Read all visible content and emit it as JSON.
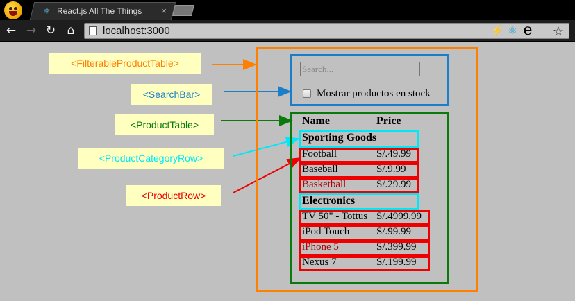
{
  "browser": {
    "tab_title": "React.js All The Things",
    "tab_close": "×",
    "url": "localhost:3000",
    "icons": {
      "back": "←",
      "forward": "→",
      "reload": "↻",
      "home": "⌂",
      "flash": "⚡",
      "react": "⚛",
      "ext_e": "e",
      "star": "☆"
    }
  },
  "labels": {
    "filterable_product_table": "<FilterableProductTable>",
    "search_bar": "<SearchBar>",
    "product_table": "<ProductTable>",
    "product_category_row": "<ProductCategoryRow>",
    "product_row": "<ProductRow>"
  },
  "colors": {
    "filterable_product_table": "#ff7f00",
    "search_bar": "#1a7fc8",
    "product_table": "#0a7a0a",
    "product_category_row": "#00e8f8",
    "product_row": "#ee0000"
  },
  "search": {
    "placeholder": "Search...",
    "checkbox_label": "Mostrar productos en stock"
  },
  "table": {
    "headers": [
      "Name",
      "Price"
    ],
    "categories": [
      {
        "name": "Sporting Goods",
        "rows": [
          {
            "name": "Football",
            "price": "S/.49.99",
            "stocked": true
          },
          {
            "name": "Baseball",
            "price": "S/.9.99",
            "stocked": true
          },
          {
            "name": "Basketball",
            "price": "S/.29.99",
            "stocked": false
          }
        ]
      },
      {
        "name": "Electronics",
        "rows": [
          {
            "name": "TV 50\" - Tottus",
            "price": "S/.4999.99",
            "stocked": true
          },
          {
            "name": "iPod Touch",
            "price": "S/.99.99",
            "stocked": true
          },
          {
            "name": "iPhone 5",
            "price": "S/.399.99",
            "stocked": false
          },
          {
            "name": "Nexus 7",
            "price": "S/.199.99",
            "stocked": true
          }
        ]
      }
    ]
  }
}
